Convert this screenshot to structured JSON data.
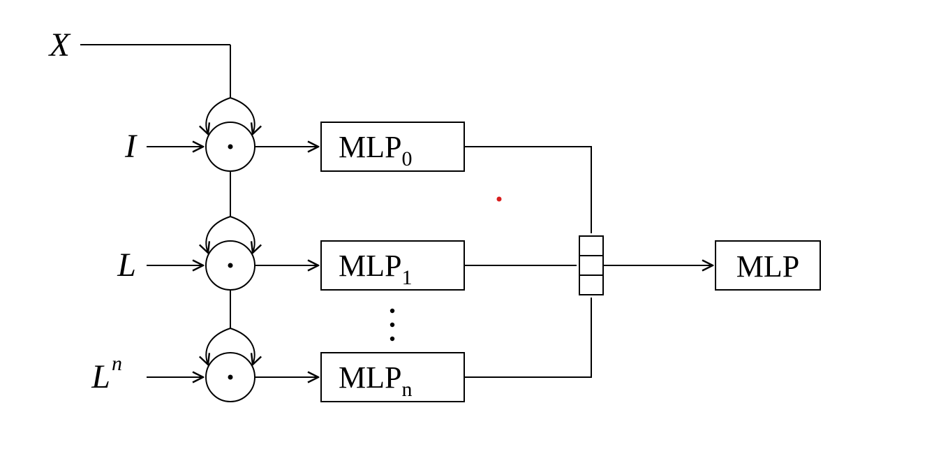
{
  "inputs": {
    "X": "X",
    "I": "I",
    "L": "L",
    "Ln_base": "L",
    "Ln_exp": "n"
  },
  "mlp": {
    "prefix": "MLP",
    "sub0": "0",
    "sub1": "1",
    "subn": "n",
    "final": "MLP"
  },
  "op_symbol": "·"
}
